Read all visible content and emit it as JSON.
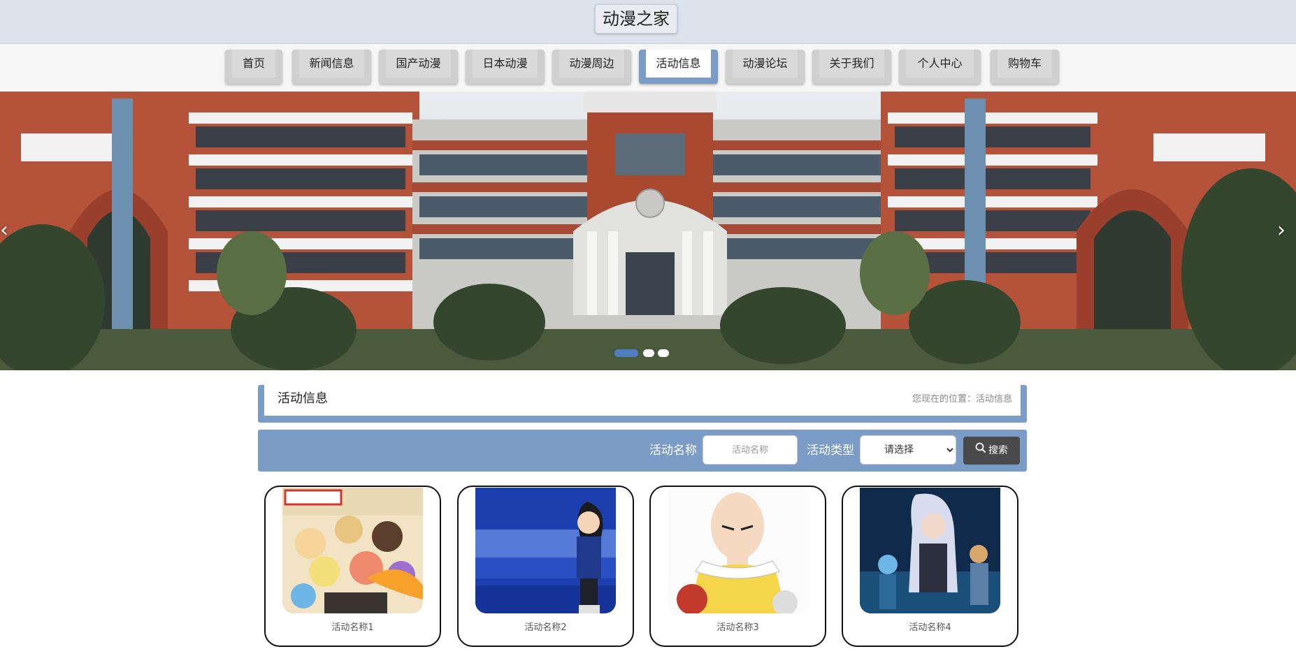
{
  "site": {
    "title": "动漫之家"
  },
  "nav": {
    "items": [
      {
        "label": "首页"
      },
      {
        "label": "新闻信息"
      },
      {
        "label": "国产动漫"
      },
      {
        "label": "日本动漫"
      },
      {
        "label": "动漫周边"
      },
      {
        "label": "活动信息"
      },
      {
        "label": "动漫论坛"
      },
      {
        "label": "关于我们"
      },
      {
        "label": "个人中心"
      },
      {
        "label": "购物车"
      }
    ],
    "active_label": "活动信息"
  },
  "banner": {
    "prev_icon": "chevron-left-icon",
    "next_icon": "chevron-right-icon",
    "slide_count": 3,
    "active_slide": 1
  },
  "section": {
    "title": "活动信息",
    "breadcrumb": "您现在的位置：活动信息"
  },
  "search": {
    "name_label": "活动名称",
    "name_placeholder": "活动名称",
    "type_label": "活动类型",
    "type_selected": "请选择",
    "button_label": "搜索",
    "button_icon": "search-icon"
  },
  "cards": [
    {
      "caption": "活动名称1"
    },
    {
      "caption": "活动名称2"
    },
    {
      "caption": "活动名称3"
    },
    {
      "caption": "活动名称4"
    }
  ],
  "colors": {
    "accent": "#7a9cc6",
    "header_bg": "#dde3ec",
    "search_button": "#4a4a4a",
    "dot_active": "#4f7fc1"
  }
}
